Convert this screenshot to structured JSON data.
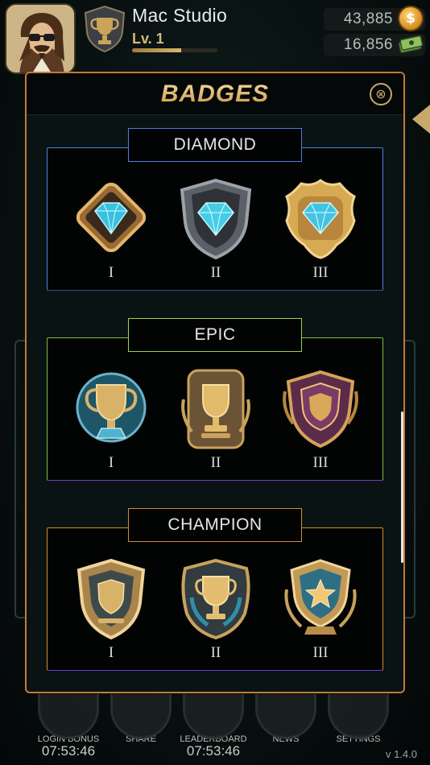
{
  "player": {
    "name": "Mac Studio",
    "level": "Lv. 1",
    "xp_progress": 0.58,
    "coins": "43,885",
    "cash": "16,856"
  },
  "icons": {
    "coin_symbol": "$"
  },
  "modal": {
    "title": "BADGES",
    "close_icon": "⊗"
  },
  "sections": [
    {
      "title": "DIAMOND",
      "accent": "#4f7ee0",
      "title_border": "#4f7ee0",
      "badges": [
        {
          "tier": "I",
          "icon": "diamond-tier-1-badge"
        },
        {
          "tier": "II",
          "icon": "diamond-shield-badge"
        },
        {
          "tier": "III",
          "icon": "diamond-gold-badge"
        }
      ]
    },
    {
      "title": "EPIC",
      "accent": "#7fbf3c",
      "title_border": "#9bd150",
      "badges": [
        {
          "tier": "I",
          "icon": "blue-trophy-badge"
        },
        {
          "tier": "II",
          "icon": "gold-trophy-badge"
        },
        {
          "tier": "III",
          "icon": "purple-shield-badge"
        }
      ]
    },
    {
      "title": "CHAMPION",
      "accent": "#d58b2d",
      "title_border": "#d58b2d",
      "badges": [
        {
          "tier": "I",
          "icon": "gold-shield-badge"
        },
        {
          "tier": "II",
          "icon": "champion-cup-badge"
        },
        {
          "tier": "III",
          "icon": "star-shield-badge"
        }
      ]
    }
  ],
  "bottom_nav": [
    {
      "label": "LOGIN BONUS",
      "timer": "07:53:46",
      "icon": "gift-icon"
    },
    {
      "label": "SHARE",
      "timer": "",
      "icon": "share-icon"
    },
    {
      "label": "LEADERBOARD",
      "timer": "07:53:46",
      "icon": "podium-icon"
    },
    {
      "label": "NEWS",
      "timer": "",
      "icon": "newspaper-icon"
    },
    {
      "label": "SETTINGS",
      "timer": "",
      "icon": "gear-icon"
    }
  ],
  "version": "v 1.4.0"
}
